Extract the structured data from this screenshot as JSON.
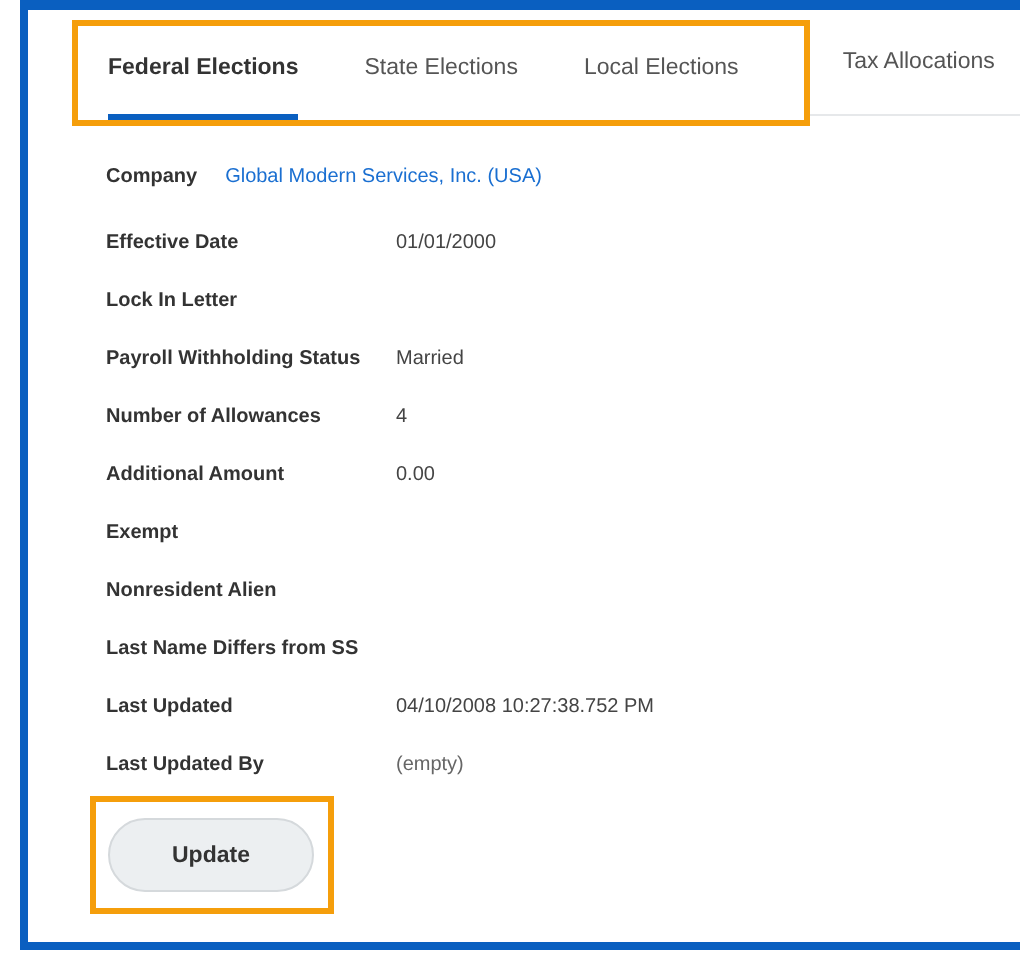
{
  "tabs": [
    {
      "label": "Federal Elections",
      "selected": true,
      "highlighted": true
    },
    {
      "label": "State Elections",
      "selected": false,
      "highlighted": true
    },
    {
      "label": "Local Elections",
      "selected": false,
      "highlighted": true
    },
    {
      "label": "Tax Allocations",
      "selected": false,
      "highlighted": false
    }
  ],
  "company": {
    "label": "Company",
    "value": "Global Modern Services, Inc. (USA)"
  },
  "fields": [
    {
      "label": "Effective Date",
      "value": "01/01/2000"
    },
    {
      "label": "Lock In Letter"
    },
    {
      "label": "Payroll Withholding Status",
      "value": "Married"
    },
    {
      "label": "Number of Allowances",
      "value": "4"
    },
    {
      "label": "Additional Amount",
      "value": "0.00"
    },
    {
      "label": "Exempt"
    },
    {
      "label": "Nonresident Alien"
    },
    {
      "label": "Last Name Differs from SS"
    },
    {
      "label": "Last Updated",
      "value": "04/10/2008 10:27:38.752 PM"
    },
    {
      "label": "Last Updated By",
      "value": "(empty)",
      "kind": "empty"
    }
  ],
  "update_button": {
    "label": "Update",
    "highlighted": true
  }
}
